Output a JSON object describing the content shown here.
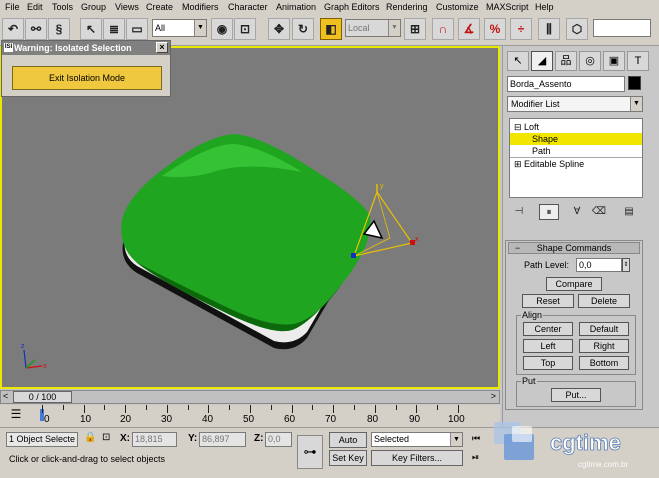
{
  "menu": [
    "File",
    "Edit",
    "Tools",
    "Group",
    "Views",
    "Create",
    "Modifiers",
    "Character",
    "Animation",
    "Graph Editors",
    "Rendering",
    "Customize",
    "MAXScript",
    "Help"
  ],
  "toolbar": {
    "selection_filter": "All",
    "reference_coord": "Local"
  },
  "dialog": {
    "title": "Warning: Isolated Selection",
    "title_icon": "ISI",
    "close_label": "×",
    "button_label": "Exit Isolation Mode"
  },
  "panel": {
    "object_name": "Borda_Assento",
    "object_color": "#000000",
    "modifier_list": "Modifier List",
    "stack": {
      "loft": "Loft",
      "shape": "Shape",
      "path": "Path",
      "editable_spline": "Editable Spline"
    },
    "rollout_title": "Shape Commands",
    "path_level_label": "Path Level:",
    "path_level_value": "0,0",
    "compare": "Compare",
    "reset": "Reset",
    "delete": "Delete",
    "align_group": "Align",
    "center": "Center",
    "default": "Default",
    "left": "Left",
    "right": "Right",
    "top": "Top",
    "bottom": "Bottom",
    "put_group": "Put",
    "put_button": "Put..."
  },
  "timeline": {
    "frame_display": "0 / 100",
    "ticks": [
      "0",
      "10",
      "20",
      "30",
      "40",
      "50",
      "60",
      "70",
      "80",
      "90",
      "100"
    ]
  },
  "status": {
    "selection": "1 Object Selecte",
    "x_label": "X:",
    "x_value": "18,815",
    "y_label": "Y:",
    "y_value": "86,897",
    "z_label": "Z:",
    "z_value": "0,0",
    "auto_key": "Auto Key",
    "set_key": "Set Key",
    "selected": "Selected",
    "key_filters": "Key Filters...",
    "prompt": "Click or click-and-drag to select objects"
  },
  "watermark": {
    "brand": "cgtime",
    "url": "cgtime.com.br"
  },
  "colors": {
    "object_green": "#1fa51f",
    "viewport_bg": "#7b7b7b",
    "viewport_border": "#e8e800",
    "selection_yellow": "#f2e600",
    "dialog_button": "#f0c840"
  }
}
